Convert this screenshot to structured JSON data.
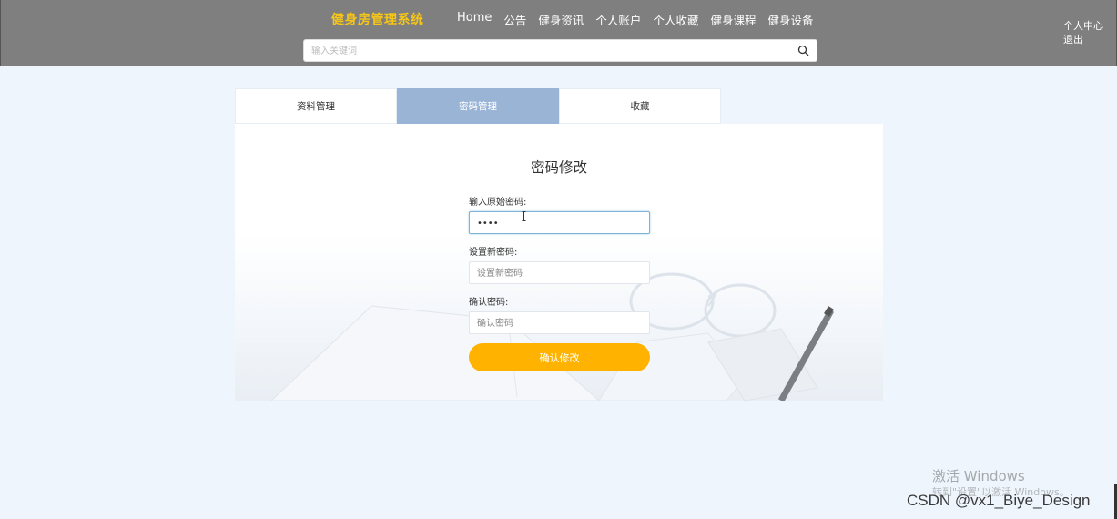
{
  "header": {
    "brand": "健身房管理系统",
    "nav": [
      "Home",
      "公告",
      "健身资讯",
      "个人账户",
      "个人收藏",
      "健身课程",
      "健身设备"
    ],
    "search_placeholder": "输入关键词",
    "user_center": "个人中心",
    "logout": "退出"
  },
  "tabs": [
    {
      "label": "资料管理",
      "active": false
    },
    {
      "label": "密码管理",
      "active": true
    },
    {
      "label": "收藏",
      "active": false
    }
  ],
  "form": {
    "title": "密码修改",
    "old_password_label": "输入原始密码:",
    "old_password_value": "••••",
    "new_password_label": "设置新密码:",
    "new_password_placeholder": "设置新密码",
    "confirm_label": "确认密码:",
    "confirm_placeholder": "确认密码",
    "submit_label": "确认修改"
  },
  "colors": {
    "header_bg": "#7f7f7f",
    "brand": "#f5c518",
    "active_tab": "#9ab4d6",
    "submit": "#ffb300",
    "page_bg": "#eef5fd"
  },
  "overlay": {
    "activate_windows": "激活 Windows",
    "activate_windows_sub": "转到\"设置\"以激活 Windows。",
    "watermark": "CSDN @vx1_Biye_Design"
  }
}
